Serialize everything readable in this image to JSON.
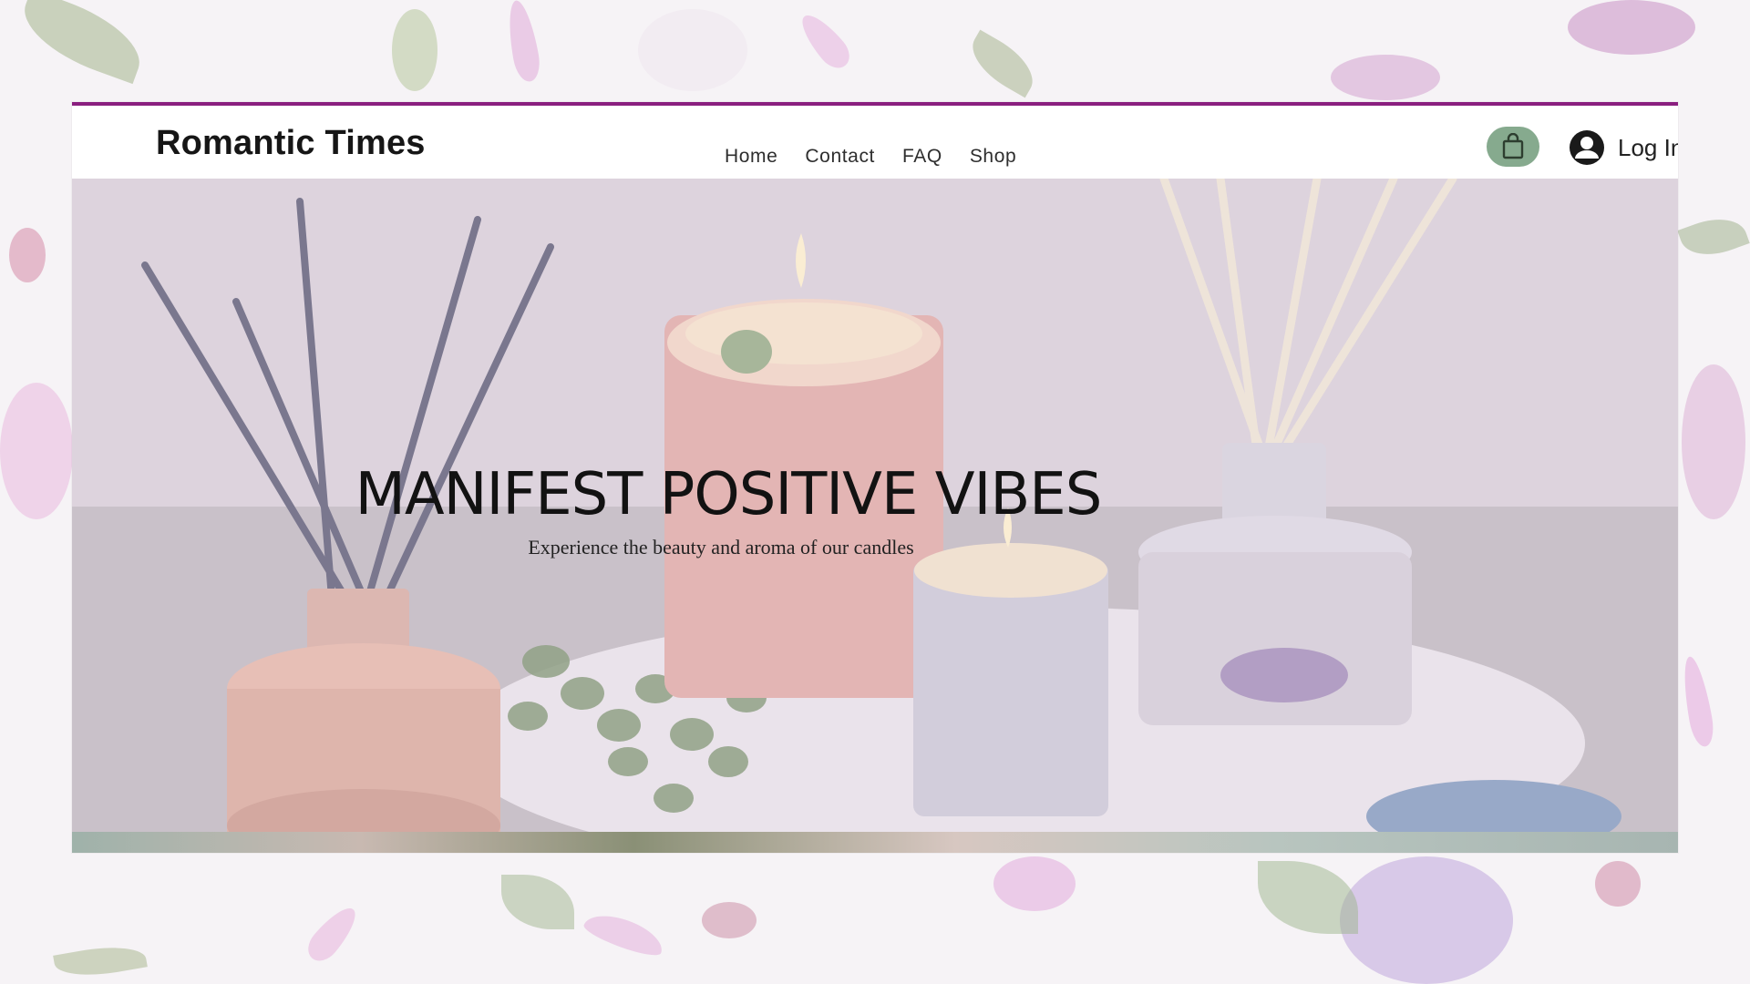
{
  "brand": {
    "name": "Romantic Times"
  },
  "nav": {
    "items": [
      "Home",
      "Contact",
      "FAQ",
      "Shop"
    ]
  },
  "header": {
    "login_label": "Log In"
  },
  "hero": {
    "title": "MANIFEST POSITIVE VIBES",
    "subtitle": "Experience the beauty and aroma of our candles"
  },
  "colors": {
    "accent": "#8a1f7f",
    "cart_button": "#86aa8e"
  },
  "icons": {
    "cart": "shopping-bag-icon",
    "account": "account-avatar-icon"
  }
}
